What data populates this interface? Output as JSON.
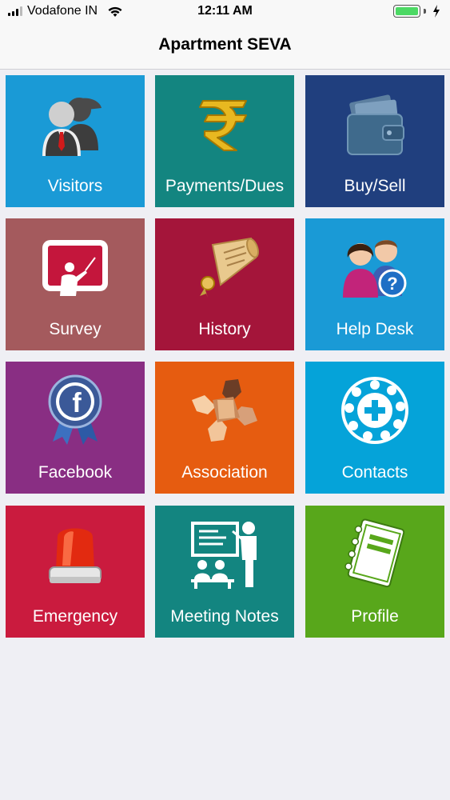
{
  "status_bar": {
    "carrier": "Vodafone IN",
    "time": "12:11 AM"
  },
  "nav": {
    "title": "Apartment SEVA"
  },
  "tiles": [
    {
      "label": "Visitors",
      "color": "#1a9ad6",
      "icon": "visitors-icon"
    },
    {
      "label": "Payments/Dues",
      "color": "#138580",
      "icon": "rupee-icon"
    },
    {
      "label": "Buy/Sell",
      "color": "#203f7e",
      "icon": "wallet-icon"
    },
    {
      "label": "Survey",
      "color": "#a45a5d",
      "icon": "presentation-board-icon"
    },
    {
      "label": "History",
      "color": "#a4153a",
      "icon": "scroll-icon"
    },
    {
      "label": "Help Desk",
      "color": "#1a9ad6",
      "icon": "help-people-icon"
    },
    {
      "label": "Facebook",
      "color": "#892e83",
      "icon": "facebook-badge-icon"
    },
    {
      "label": "Association",
      "color": "#e65c10",
      "icon": "joined-hands-icon"
    },
    {
      "label": "Contacts",
      "color": "#05a3d9",
      "icon": "rotary-dial-icon"
    },
    {
      "label": "Emergency",
      "color": "#ca1b3e",
      "icon": "siren-icon"
    },
    {
      "label": "Meeting Notes",
      "color": "#138580",
      "icon": "meeting-icon"
    },
    {
      "label": "Profile",
      "color": "#58a71b",
      "icon": "notebook-icon"
    }
  ]
}
